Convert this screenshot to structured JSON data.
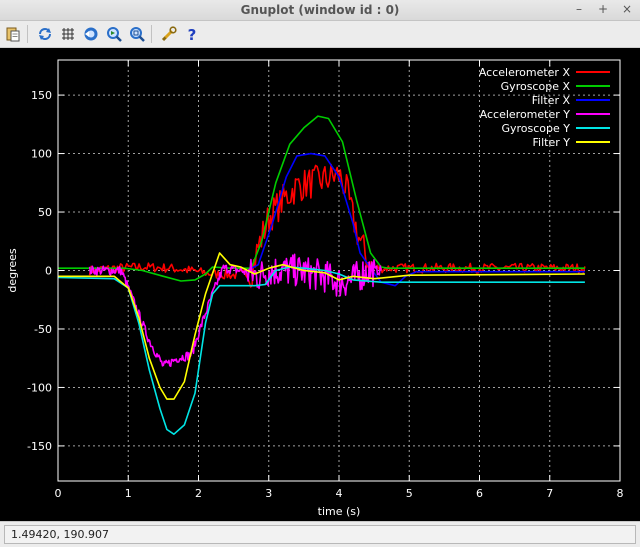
{
  "window": {
    "title": "Gnuplot (window id : 0)",
    "controls": {
      "minimize": "–",
      "maximize": "+",
      "close": "×"
    }
  },
  "toolbar": {
    "buttons": [
      {
        "name": "copy-to-clipboard",
        "icon": "clipboard-icon"
      },
      {
        "name": "replot",
        "icon": "replot-icon"
      },
      {
        "name": "toggle-grid",
        "icon": "grid-icon"
      },
      {
        "name": "previous-zoom",
        "icon": "zoom-previous-icon"
      },
      {
        "name": "next-zoom",
        "icon": "zoom-next-icon"
      },
      {
        "name": "autoscale",
        "icon": "zoom-autoscale-icon"
      },
      {
        "name": "settings",
        "icon": "wrench-icon"
      },
      {
        "name": "help",
        "icon": "help-icon"
      }
    ]
  },
  "status": {
    "coords": "1.49420,  190.907"
  },
  "chart_data": {
    "type": "line",
    "xlabel": "time (s)",
    "ylabel": "degrees",
    "xlim": [
      0,
      8
    ],
    "ylim": [
      -180,
      180
    ],
    "xticks": [
      0,
      1,
      2,
      3,
      4,
      5,
      6,
      7,
      8
    ],
    "yticks": [
      -150,
      -100,
      -50,
      0,
      50,
      100,
      150
    ],
    "grid": true,
    "legend_position": "top-right",
    "colors": {
      "background": "#000000",
      "axes": "#ffffff",
      "grid": "#a0a0a0"
    },
    "series": [
      {
        "name": "Accelerometer X",
        "color": "#ff0000",
        "noisy": true,
        "x": [
          0.45,
          0.8,
          1.2,
          1.6,
          1.9,
          2.2,
          2.5,
          2.75,
          2.85,
          3.0,
          3.2,
          3.4,
          3.6,
          3.8,
          4.0,
          4.1,
          4.2,
          4.3,
          4.45,
          4.6,
          7.5
        ],
        "y": [
          0,
          2,
          3,
          2,
          0,
          -3,
          -4,
          -2,
          20,
          45,
          60,
          72,
          75,
          78,
          82,
          70,
          45,
          25,
          3,
          2,
          2
        ]
      },
      {
        "name": "Gyroscope X",
        "color": "#00cc00",
        "noisy": false,
        "x": [
          0,
          0.95,
          1.2,
          1.5,
          1.75,
          1.95,
          2.1,
          2.2,
          2.45,
          2.75,
          2.9,
          3.1,
          3.3,
          3.5,
          3.7,
          3.85,
          4.05,
          4.25,
          4.45,
          4.6,
          4.7,
          7.5
        ],
        "y": [
          2,
          2,
          0,
          -5,
          -9,
          -8,
          -3,
          3,
          2,
          2,
          25,
          75,
          108,
          122,
          132,
          130,
          110,
          60,
          15,
          3,
          2,
          2
        ]
      },
      {
        "name": "Filter X",
        "color": "#0000ff",
        "noisy": false,
        "x": [
          2.7,
          2.85,
          3.05,
          3.25,
          3.4,
          3.6,
          3.8,
          4.0,
          4.2,
          4.3,
          4.45,
          4.6,
          4.8,
          4.95,
          5.1,
          7.5
        ],
        "y": [
          0,
          5,
          40,
          80,
          98,
          100,
          98,
          80,
          40,
          15,
          2,
          -10,
          -13,
          -5,
          -1,
          -1
        ]
      },
      {
        "name": "Accelerometer Y",
        "color": "#ff00ff",
        "noisy": true,
        "x": [
          0.45,
          0.9,
          1.1,
          1.3,
          1.5,
          1.7,
          1.9,
          2.05,
          2.2,
          2.35,
          2.6,
          2.85,
          3.0,
          3.4,
          3.8,
          4.0,
          4.2,
          4.4,
          4.6
        ],
        "y": [
          0,
          0,
          -30,
          -60,
          -82,
          -75,
          -72,
          -45,
          -20,
          2,
          0,
          -5,
          0,
          0,
          -5,
          -10,
          -8,
          0,
          0
        ]
      },
      {
        "name": "Gyroscope Y",
        "color": "#00e5e5",
        "noisy": false,
        "x": [
          0,
          0.8,
          1.0,
          1.15,
          1.3,
          1.45,
          1.55,
          1.65,
          1.8,
          1.95,
          2.1,
          2.2,
          2.3,
          2.5,
          2.8,
          2.95,
          3.1,
          3.3,
          3.5,
          3.8,
          4.0,
          4.2,
          4.6,
          7.5
        ],
        "y": [
          -6,
          -7,
          -15,
          -45,
          -85,
          -118,
          -136,
          -140,
          -132,
          -105,
          -45,
          -20,
          -13,
          -13,
          -13,
          -12,
          0,
          3,
          2,
          0,
          -3,
          -8,
          -10,
          -10
        ]
      },
      {
        "name": "Filter Y",
        "color": "#ffff00",
        "noisy": false,
        "x": [
          0,
          0.8,
          1.0,
          1.15,
          1.3,
          1.45,
          1.55,
          1.65,
          1.8,
          1.95,
          2.1,
          2.3,
          2.45,
          2.6,
          2.8,
          3.0,
          3.2,
          3.5,
          3.8,
          4.0,
          4.2,
          4.5,
          5.0,
          7.5
        ],
        "y": [
          -5,
          -5,
          -15,
          -40,
          -75,
          -100,
          -110,
          -110,
          -95,
          -55,
          -20,
          15,
          5,
          3,
          -3,
          2,
          5,
          0,
          -2,
          -8,
          -5,
          -7,
          -4,
          -3
        ]
      }
    ]
  }
}
